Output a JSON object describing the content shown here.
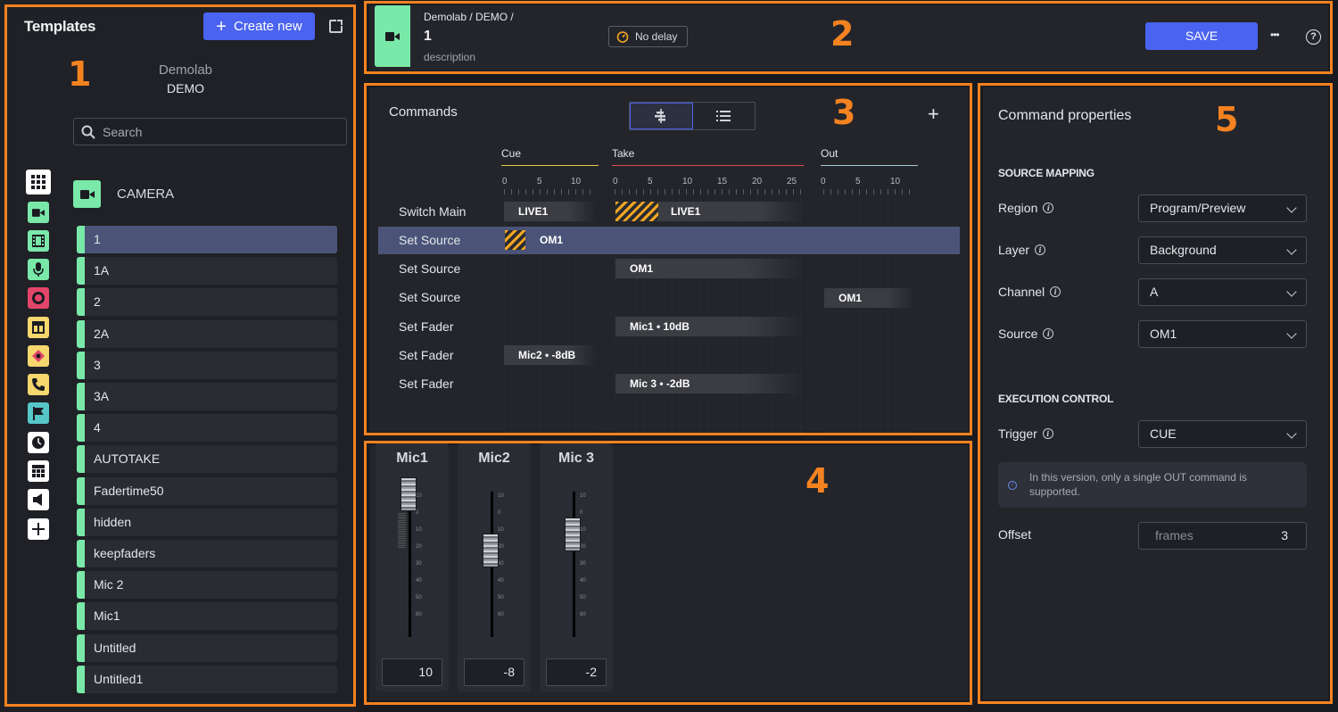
{
  "annotations": [
    "1",
    "2",
    "3",
    "4",
    "5"
  ],
  "sidebar": {
    "title": "Templates",
    "create_label": "Create new",
    "org": "Demolab",
    "project": "DEMO",
    "search_placeholder": "Search",
    "category": "CAMERA",
    "categories": [
      {
        "icon": "grid-icon",
        "color": "#ffffff"
      },
      {
        "icon": "camera-icon",
        "color": "#79e8a8"
      },
      {
        "icon": "film-icon",
        "color": "#79e8a8"
      },
      {
        "icon": "mic-icon",
        "color": "#79e8a8"
      },
      {
        "icon": "record-icon",
        "color": "#e2456a"
      },
      {
        "icon": "layout-icon",
        "color": "#f5d76e"
      },
      {
        "icon": "graphics-icon",
        "color": "#f5d76e"
      },
      {
        "icon": "phone-icon",
        "color": "#f5d76e"
      },
      {
        "icon": "flag-icon",
        "color": "#56c6c8"
      },
      {
        "icon": "clock-icon",
        "color": "#ffffff"
      },
      {
        "icon": "windows-icon",
        "color": "#ffffff"
      },
      {
        "icon": "speaker-icon",
        "color": "#ffffff"
      },
      {
        "icon": "add-icon",
        "color": "#ffffff"
      }
    ],
    "items": [
      "1",
      "1A",
      "2",
      "2A",
      "3",
      "3A",
      "4",
      "AUTOTAKE",
      "Fadertime50",
      "hidden",
      "keepfaders",
      "Mic 2",
      "Mic1",
      "Untitled",
      "Untitled1"
    ],
    "selected_item": "1"
  },
  "header": {
    "breadcrumb": "Demolab / DEMO /",
    "name": "1",
    "description": "description",
    "delay_label": "No delay",
    "save_label": "SAVE",
    "more_label": "•••",
    "help_label": "?"
  },
  "commands": {
    "title": "Commands",
    "add_label": "+",
    "phases": [
      {
        "name": "Cue",
        "color": "#e8c84a",
        "ticks": [
          "0",
          "5",
          "10"
        ]
      },
      {
        "name": "Take",
        "color": "#e04a4a",
        "ticks": [
          "0",
          "5",
          "10",
          "15",
          "20",
          "25"
        ]
      },
      {
        "name": "Out",
        "color": "#a8c8d8",
        "ticks": [
          "0",
          "5",
          "10"
        ]
      }
    ],
    "rows": [
      {
        "label": "Switch Main",
        "bars": [
          "LIVE1",
          "LIVE1"
        ]
      },
      {
        "label": "Set Source",
        "bars": [
          "OM1"
        ],
        "selected": true
      },
      {
        "label": "Set Source",
        "bars": [
          "OM1"
        ]
      },
      {
        "label": "Set Source",
        "bars": [
          "OM1"
        ]
      },
      {
        "label": "Set Fader",
        "bars": [
          "Mic1 • 10dB"
        ]
      },
      {
        "label": "Set Fader",
        "bars": [
          "Mic2 • -8dB"
        ]
      },
      {
        "label": "Set Fader",
        "bars": [
          "Mic 3 • -2dB"
        ]
      }
    ]
  },
  "mixer": {
    "scale": [
      "10",
      "0",
      "10",
      "20",
      "30",
      "40",
      "50",
      "60"
    ],
    "channels": [
      {
        "name": "Mic1",
        "value": "10"
      },
      {
        "name": "Mic2",
        "value": "-8"
      },
      {
        "name": "Mic 3",
        "value": "-2"
      }
    ]
  },
  "properties": {
    "title": "Command properties",
    "source_mapping": "SOURCE MAPPING",
    "region_label": "Region",
    "region_value": "Program/Preview",
    "layer_label": "Layer",
    "layer_value": "Background",
    "channel_label": "Channel",
    "channel_value": "A",
    "source_label": "Source",
    "source_value": "OM1",
    "execution_control": "EXECUTION CONTROL",
    "trigger_label": "Trigger",
    "trigger_value": "CUE",
    "notice": "In this version, only a single OUT command is supported.",
    "offset_label": "Offset",
    "offset_placeholder": "frames",
    "offset_value": "3"
  }
}
